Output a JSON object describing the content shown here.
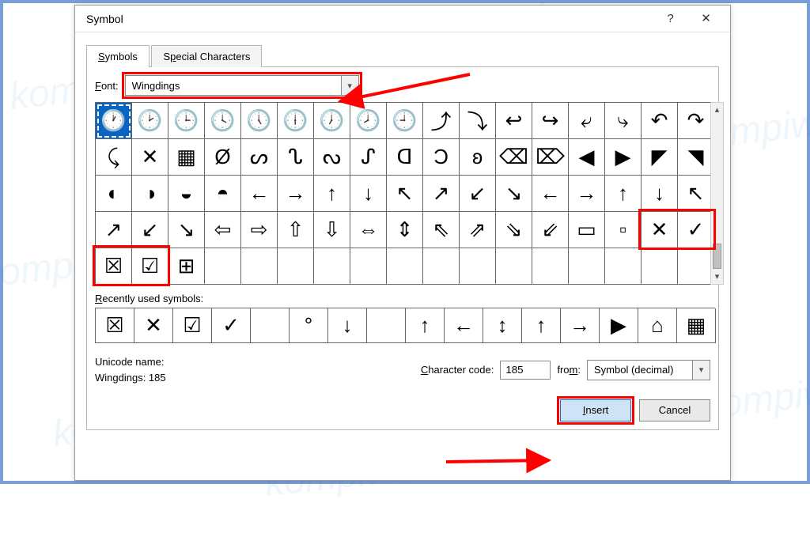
{
  "window": {
    "title": "Symbol",
    "help": "?",
    "close": "✕"
  },
  "tabs": {
    "symbols": "Symbols",
    "special": "Special Characters"
  },
  "font": {
    "label": "Font:",
    "value": "Wingdings"
  },
  "grid": {
    "rows": [
      [
        "🕐",
        "🕑",
        "🕒",
        "🕓",
        "🕔",
        "🕕",
        "🕖",
        "🕗",
        "🕘",
        "⤴",
        "⤵",
        "↩",
        "↪",
        "⤶",
        "⤷",
        "↶",
        "↷"
      ],
      [
        "⤹",
        "✕",
        "▦",
        "Ø",
        "ᔕ",
        "ᔐ",
        "ᔓ",
        "ᔑ",
        "ᗡ",
        "Ɔ",
        "ʚ",
        "⌫",
        "⌦",
        "◀",
        "▶",
        "◤",
        "◥"
      ],
      [
        "◐",
        "◑",
        "◒",
        "◓",
        "←",
        "→",
        "↑",
        "↓",
        "↖",
        "↗",
        "↙",
        "↘",
        "←",
        "→",
        "↑",
        "↓",
        "↖"
      ],
      [
        "↗",
        "↙",
        "↘",
        "⇦",
        "⇨",
        "⇧",
        "⇩",
        "⇔",
        "⇕",
        "⇖",
        "⇗",
        "⇘",
        "⇙",
        "▭",
        "▫",
        "✕",
        "✓"
      ],
      [
        "☒",
        "☑",
        "⊞",
        "",
        "",
        "",
        "",
        "",
        "",
        "",
        "",
        "",
        "",
        "",
        "",
        "",
        ""
      ]
    ],
    "selected": [
      0,
      0
    ]
  },
  "recent": {
    "label": "Recently used symbols:",
    "items": [
      "☒",
      "✕",
      "☑",
      "✓",
      "",
      "°",
      "↓",
      "",
      "↑",
      "←",
      "↕",
      "↑",
      "→",
      "▶",
      "⌂",
      "▦"
    ]
  },
  "info": {
    "unicode_label": "Unicode name:",
    "unicode_value": "Wingdings: 185",
    "code_label": "Character code:",
    "code_value": "185",
    "from_label": "from:",
    "from_value": "Symbol (decimal)"
  },
  "buttons": {
    "insert": "Insert",
    "cancel": "Cancel"
  }
}
